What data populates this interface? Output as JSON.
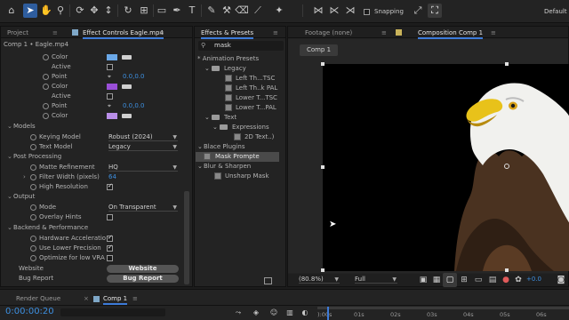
{
  "toolbar": {
    "snapping_label": "Snapping",
    "workspace_label": "Default"
  },
  "project_panel": {
    "tab_project": "Project",
    "tab_effect_controls": "Effect Controls Eagle.mp4",
    "breadcrumb": "Comp 1 • Eagle.mp4",
    "rows": {
      "color1": "Color",
      "active1": "Active",
      "point1": "Point",
      "point1_value": "0.0,0.0",
      "color2": "Color",
      "active2": "Active",
      "point2": "Point",
      "point2_value": "0.0,0.0",
      "color3": "Color",
      "models": "Models",
      "keying_model": "Keying Model",
      "keying_model_value": "Robust (2024)",
      "text_model": "Text Model",
      "text_model_value": "Legacy",
      "post_processing": "Post Processing",
      "matte_refinement": "Matte Refinement",
      "matte_refinement_value": "HQ",
      "filter_width": "Filter Width (pixels)",
      "filter_width_value": "64",
      "high_resolution": "High Resolution",
      "output": "Output",
      "mode": "Mode",
      "mode_value": "On Transparent",
      "overlay_hints": "Overlay Hints",
      "backend": "Backend & Performance",
      "hw_accel": "Hardware Acceleratio",
      "lower_precision": "Use Lower Precision",
      "optimize_vra": "Optimize for low VRA",
      "website": "Website",
      "website_btn": "Website",
      "bug_report": "Bug Report",
      "bug_report_btn": "Bug Report"
    },
    "swatch_color1": "#6aa8e8",
    "swatch_color2": "#9a4fd8",
    "swatch_color3": "#b98ee8"
  },
  "effects_panel": {
    "title": "Effects & Presets",
    "search_value": "mask",
    "tree": {
      "animation_presets": "* Animation Presets",
      "legacy": "Legacy",
      "left_tsc": "Left Th...TSC",
      "left_kpal": "Left Th..k PAL",
      "lower_tsc": "Lower T...TSC",
      "lower_tpal": "Lower T...PAL",
      "text": "Text",
      "expressions": "Expressions",
      "text_2d": "2D Text..)",
      "blace_plugins": "Blace Plugins",
      "mask_prompter": "Mask Prompte",
      "blur_sharpen": "Blur & Sharpen",
      "unsharp_mask": "Unsharp Mask"
    }
  },
  "viewer": {
    "tab_footage": "Footage (none)",
    "tab_composition": "Composition Comp 1",
    "comp_chip": "Comp 1",
    "zoom": "(80.8%)",
    "resolution": "Full",
    "exposure": "+0.0"
  },
  "timeline": {
    "tab_render_queue": "Render Queue",
    "tab_comp": "Comp 1",
    "timecode": "0:00:00:20",
    "ruler": [
      "):00s",
      "01s",
      "02s",
      "03s",
      "04s",
      "05s",
      "06s"
    ]
  },
  "colors": {
    "accent_blue": "#3d7bd9",
    "timecode_blue": "#3d8fe0"
  }
}
